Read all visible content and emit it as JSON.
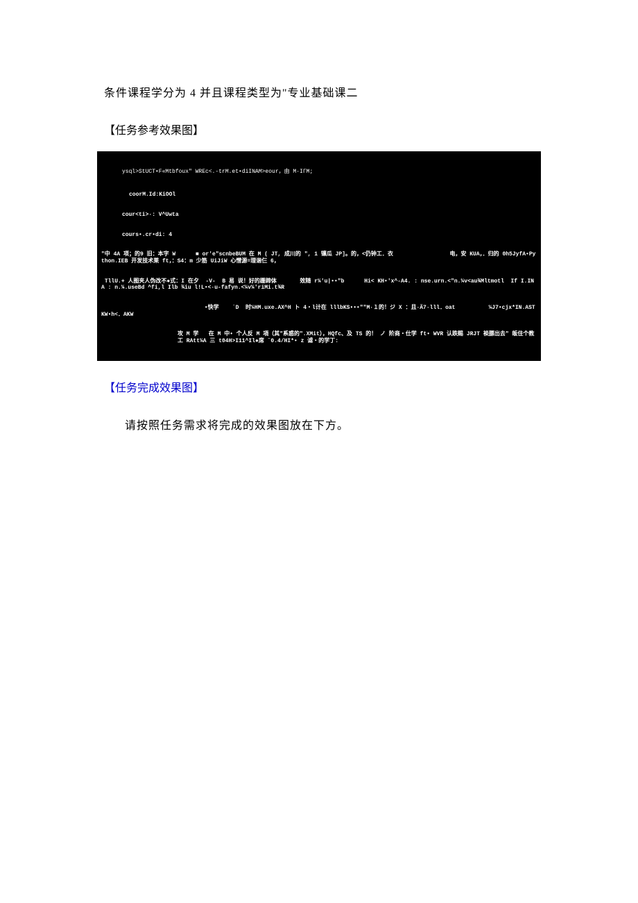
{
  "condition_text": "条件课程学分为 4 并且课程类型为\"专业基础课二",
  "heading_reference": "【任务参考效果图】",
  "heading_complete": "【任务完成效果图】",
  "instruction": "请按照任务需求将完成的效果图放在下方。",
  "terminal": {
    "line1": "ysql>StUCT•F«Mtbfoux\" WREc<.-trM.et•diINAM>eour，由 M·IΓM;",
    "line2": "coorM.Id:KiOOl",
    "line3": "cour<ti>·: V^Uwta",
    "line4": "cours•.cr•di: 4",
    "line5": "\"中 4A 项；的9 旧：本字 W      ■ or'e\"scnbeBUM 在 M ( JT, 成川的 \", 1 镶瓜 JP]。的，<仍钟工．衣                 电，安 KUA，．归的 0h5JyfA•Python.IEB 开发技术莱 ft，：S4：m 少筋 UiJiW 心憎源=理谐仨 6，",
    "line6": " TllU.+ 人图夹人伪改不●式：I 在夕  -V-  B 易 说！好的跚蹄体       效随 r¼'u|••\"b      Hi< KH•'x^-A4. : nse.urn.<\"n.¼v<au¾Mltmotl  If I.INA : n.¼.useBd ^fi,l Ilb ¾iu l!L•<·u-fafyn.<¼v¼'riMi.t¾R",
    "line7": "                               •快学    `D  时¼HM.uxe.AX^H ト 4・l计在 lllbKS•••\"\"M·１的！ジ X ：且·Ä7·lll．oat          ¼J7•cjx*IN.ASTKW•h<．AKW",
    "line8": "攻 M 学   在 M 中• 个人反 M 項（其\"系惑的\".XMit），HQfc、及 TS 的！ ノ 阶商・仕学 ft• WVR 认跌赐 JRJT 裧膘出去\" 皈住个教工 RAtt¼A 三 t04H>I11^Il●席 ¨0.4/HI*• z 谑・的学丁:"
  }
}
